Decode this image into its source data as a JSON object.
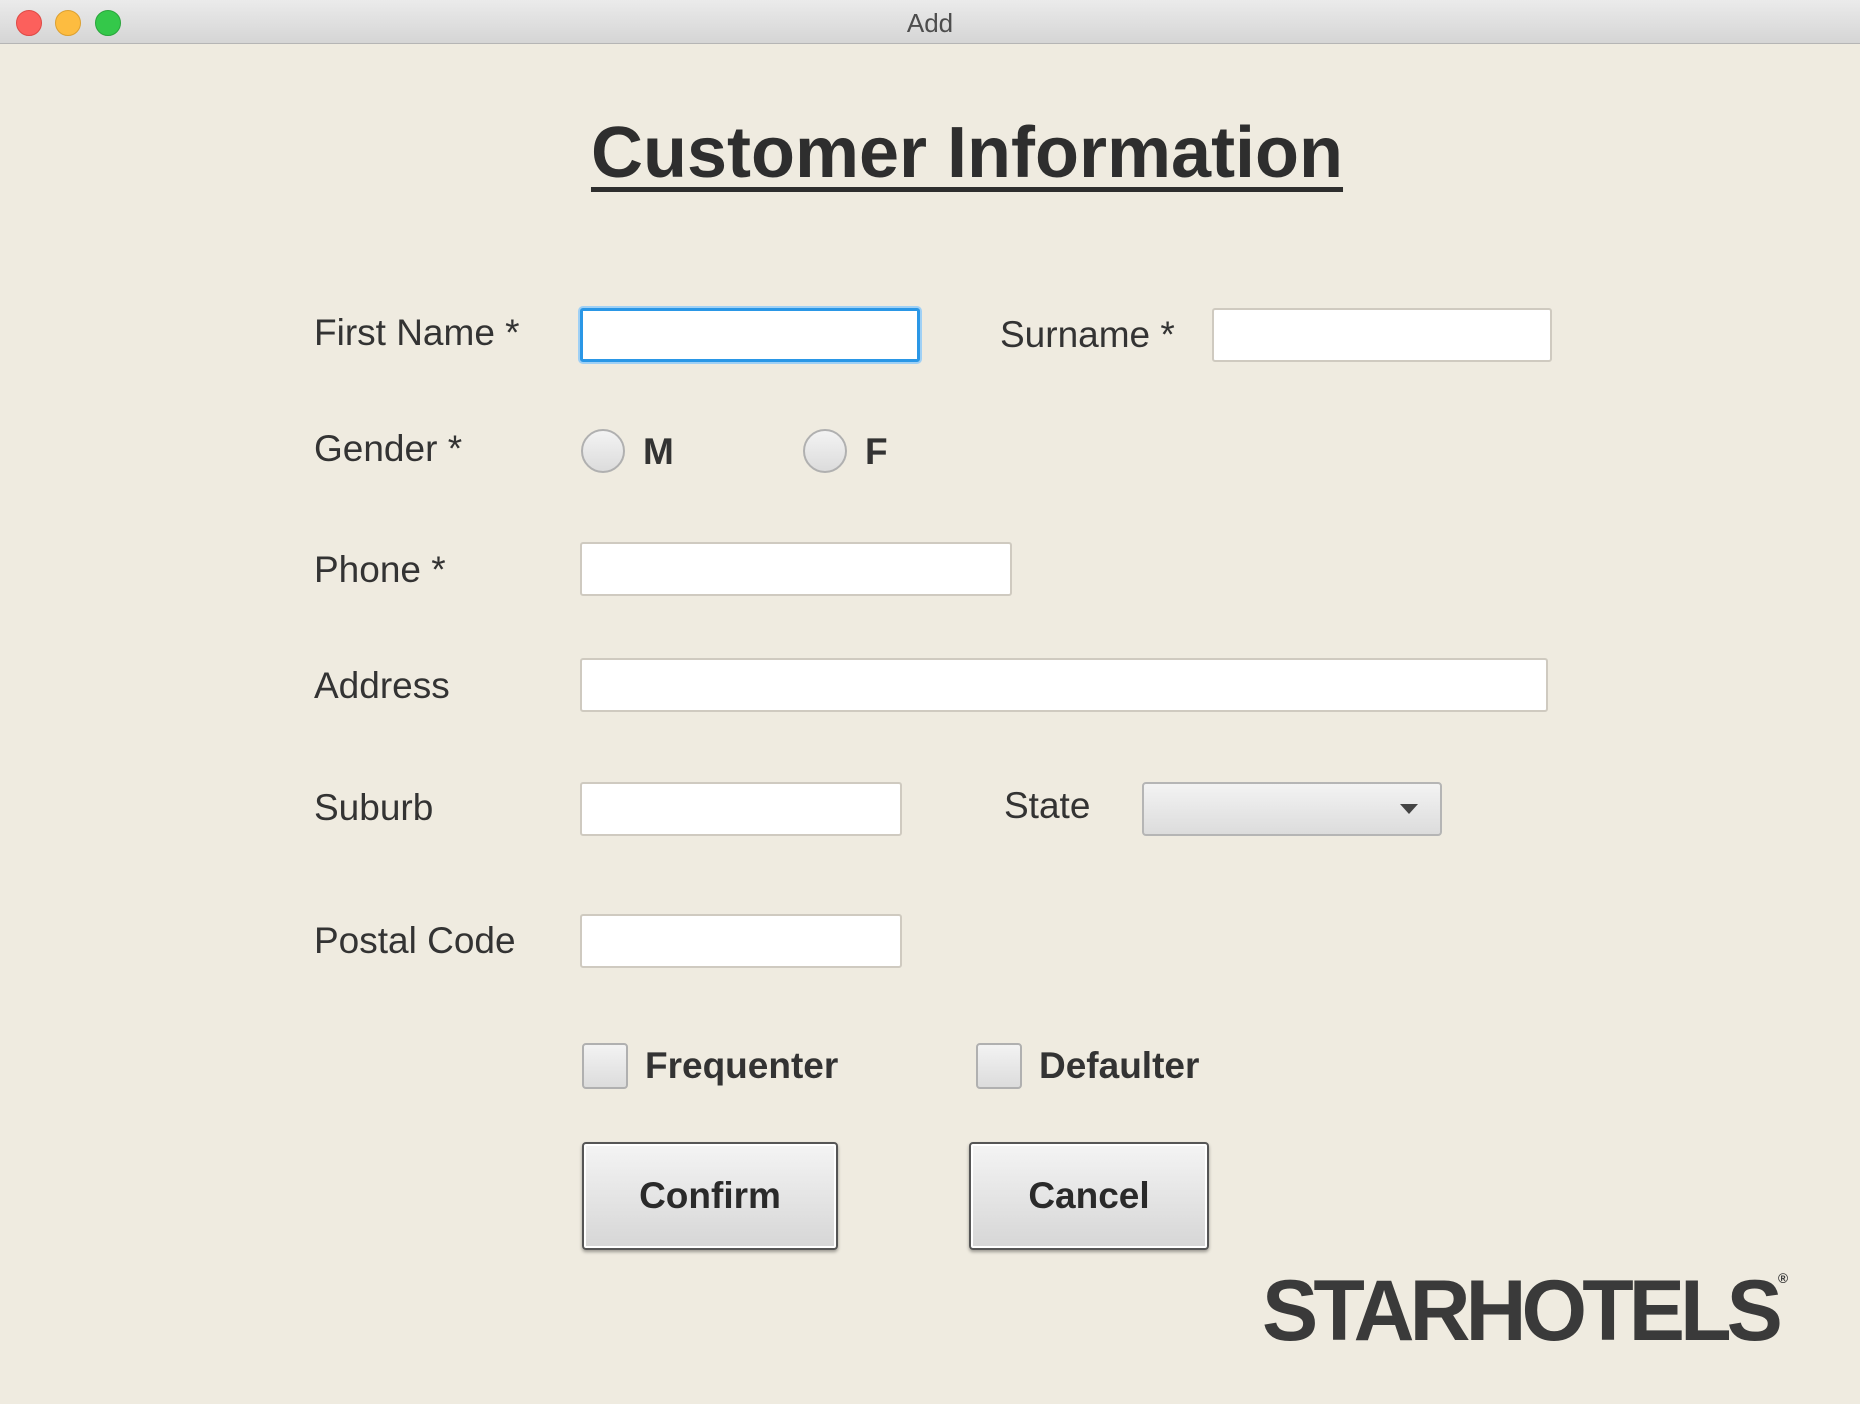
{
  "window": {
    "title": "Add"
  },
  "form": {
    "heading": "Customer Information",
    "first_name": {
      "label": "First Name *",
      "value": ""
    },
    "surname": {
      "label": "Surname *",
      "value": ""
    },
    "gender": {
      "label": "Gender *",
      "options": [
        "M",
        "F"
      ],
      "selected": null
    },
    "phone": {
      "label": "Phone *",
      "value": ""
    },
    "address": {
      "label": "Address",
      "value": ""
    },
    "suburb": {
      "label": "Suburb",
      "value": ""
    },
    "state": {
      "label": "State",
      "selected": ""
    },
    "postal_code": {
      "label": "Postal Code",
      "value": ""
    },
    "checkboxes": [
      {
        "label": "Frequenter",
        "checked": false
      },
      {
        "label": "Defaulter",
        "checked": false
      }
    ],
    "buttons": {
      "confirm": "Confirm",
      "cancel": "Cancel"
    }
  },
  "logo": {
    "text": "STARHOTELS",
    "mark": "®"
  },
  "colors": {
    "background": "#efebe0",
    "focus": "#2a97e6"
  }
}
